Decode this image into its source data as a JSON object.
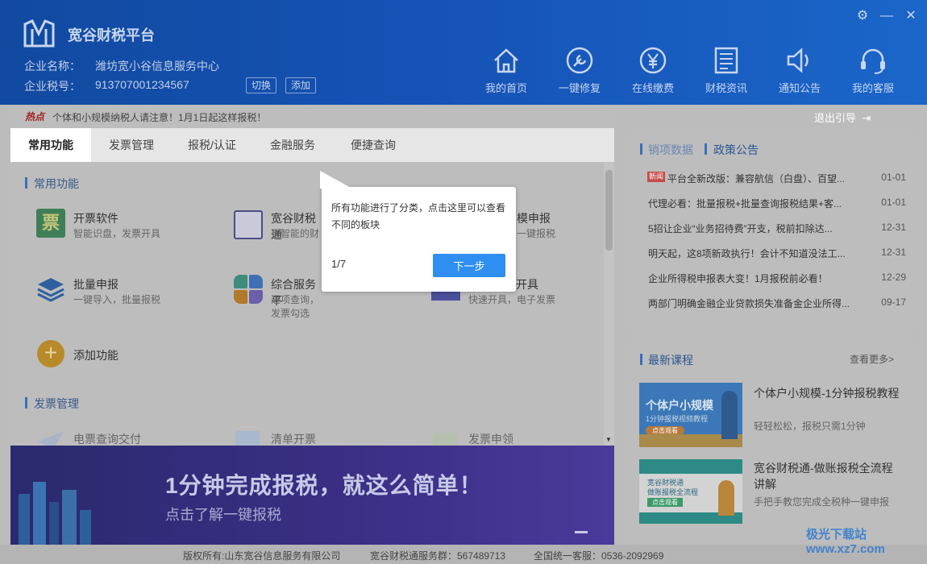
{
  "app": {
    "title": "宽谷财税平台"
  },
  "company": {
    "name_label": "企业名称：",
    "name_value": "潍坊宽小谷信息服务中心",
    "tax_label": "企业税号：",
    "tax_value": "913707001234567",
    "switch_label": "切换",
    "add_label": "添加"
  },
  "nav": [
    {
      "label": "我的首页",
      "icon": "home-icon"
    },
    {
      "label": "一键修复",
      "icon": "wrench-icon"
    },
    {
      "label": "在线缴费",
      "icon": "yuan-icon"
    },
    {
      "label": "财税资讯",
      "icon": "newspaper-icon"
    },
    {
      "label": "通知公告",
      "icon": "speaker-icon"
    },
    {
      "label": "我的客服",
      "icon": "headset-icon"
    }
  ],
  "hot": {
    "tag": "热点",
    "text": "个体和小规模纳税人请注意！1月1日起这样报税！"
  },
  "exit_guide": "退出引导",
  "tabs": [
    "常用功能",
    "发票管理",
    "报税/认证",
    "金融服务",
    "便捷查询"
  ],
  "section_common": "常用功能",
  "functions": [
    {
      "name": "开票软件",
      "desc": "智能识盘，发票开具",
      "icon": "invoice-icon"
    },
    {
      "name": "宽谷财税通",
      "desc": "更智能的财",
      "icon": "calculator-icon"
    },
    {
      "name": "模申报",
      "desc": "一键报税",
      "icon": "declare-icon"
    },
    {
      "name": "批量申报",
      "desc": "一键导入，批量报税",
      "icon": "layers-icon"
    },
    {
      "name": "综合服务平",
      "desc": "进项查询，发票勾选",
      "icon": "grid-icon"
    },
    {
      "name": "开具",
      "desc": "快速开具，电子发票",
      "icon": "e-invoice-icon"
    }
  ],
  "add_function": "添加功能",
  "section_invoice": "发票管理",
  "invoice_functions": [
    {
      "name": "电票查询交付"
    },
    {
      "name": "清单开票"
    },
    {
      "name": "发票申领"
    }
  ],
  "banner": {
    "title": "1分钟完成报税，就这么简单！",
    "subtitle": "点击了解一键报税"
  },
  "news": {
    "tab1": "销项数据",
    "tab2": "政策公告",
    "new_badge": "新闻",
    "items": [
      {
        "title": "平台全新改版：兼容航信（白盘）、百望...",
        "date": "01-01"
      },
      {
        "title": "代理必看：批量报税+批量查询报税结果+客...",
        "date": "01-01"
      },
      {
        "title": "5招让企业“业务招待费”开支，税前扣除达...",
        "date": "12-31"
      },
      {
        "title": "明天起，这8项新政执行！会计不知道没法工...",
        "date": "12-31"
      },
      {
        "title": "企业所得税申报表大变！1月报税前必看！",
        "date": "12-29"
      },
      {
        "title": "两部门明确金融企业贷款损失准备金企业所得...",
        "date": "09-17"
      }
    ]
  },
  "courses": {
    "heading": "最新课程",
    "more": "查看更多>",
    "items": [
      {
        "title": "个体户小规模-1分钟报税教程",
        "desc": "轻轻松松，报税只需1分钟",
        "thumb_title": "个体户小规模",
        "thumb_sub": "1分钟报税视频教程",
        "thumb_btn": "点击观看"
      },
      {
        "title": "宽谷财税通-做账报税全流程讲解",
        "desc": "手把手教您完成全税种一键申报",
        "thumb_title": "宽谷财税通",
        "thumb_sub": "做账报税全流程",
        "thumb_btn": "点击观看"
      }
    ]
  },
  "footer": {
    "copyright": "版权所有:山东宽谷信息服务有限公司",
    "group": "宽谷财税通服务群：567489713",
    "hotline": "全国统一客服：0536-2092969"
  },
  "popup": {
    "message": "所有功能进行了分类，点击这里可以查看不同的板块",
    "step": "1/7",
    "next_label": "下一步"
  },
  "watermark": "极光下载站 www.xz7.com"
}
